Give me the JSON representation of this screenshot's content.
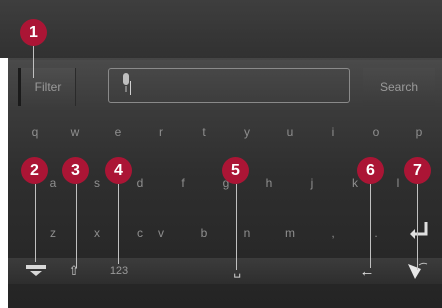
{
  "filter_button": {
    "label": "Filter"
  },
  "search_button": {
    "label": "Search"
  },
  "keyboard": {
    "row1": [
      "q",
      "w",
      "e",
      "r",
      "t",
      "y",
      "u",
      "i",
      "o",
      "p"
    ],
    "row2": [
      "a",
      "s",
      "d",
      "f",
      "g",
      "h",
      "j",
      "k",
      "l"
    ],
    "row3": [
      "z",
      "x",
      "c",
      "v",
      "b",
      "n",
      "m",
      ",",
      "."
    ],
    "numbers_label": "123",
    "space_symbol": "␣",
    "backspace_symbol": "←",
    "shift_symbol": "⇧"
  },
  "callouts": [
    "1",
    "2",
    "3",
    "4",
    "5",
    "6",
    "7"
  ],
  "colors": {
    "callout": "#ab1535",
    "background": "#2f2f2f",
    "key_text": "#8f8f8f"
  }
}
